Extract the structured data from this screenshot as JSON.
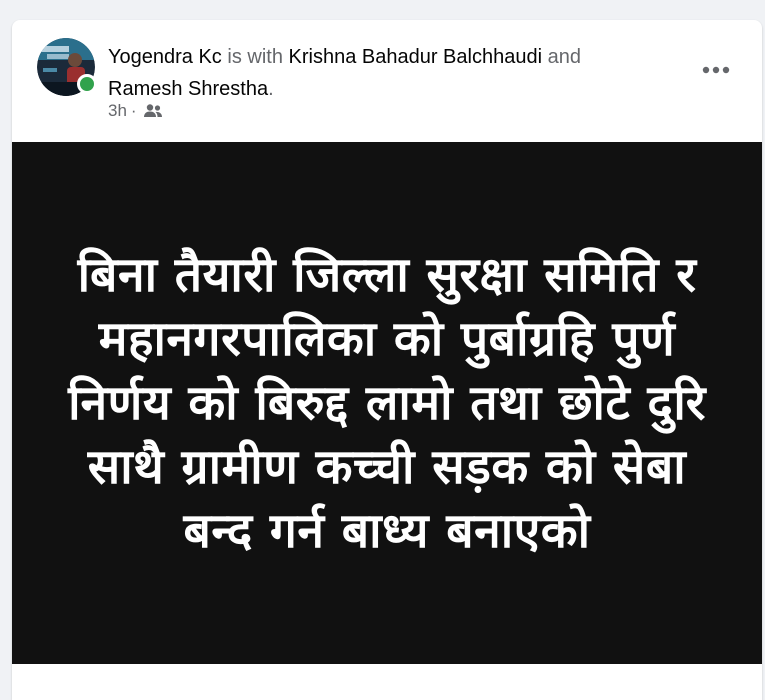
{
  "post": {
    "author": "Yogendra Kc",
    "with_text": "is with",
    "tagged_1": "Krishna Bahadur Balchhaudi",
    "and_text": "and",
    "tagged_2": "Ramesh Shrestha",
    "period": ".",
    "timestamp": "3h",
    "separator": "·",
    "audience_icon": "friends-icon",
    "more_icon": "more-horizontal-icon",
    "online_color": "#31a24c"
  },
  "image": {
    "text": "बिना तैयारी जिल्ला सुरक्षा समिति र महानगरपालिका को पुर्बाग्रहि पुर्ण निर्णय को बिरुद्द लामो तथा छोटे दुरि साथै ग्रामीण कच्ची सड़क को सेबा बन्द गर्न बाध्य बनाएको",
    "background": "#111111"
  }
}
